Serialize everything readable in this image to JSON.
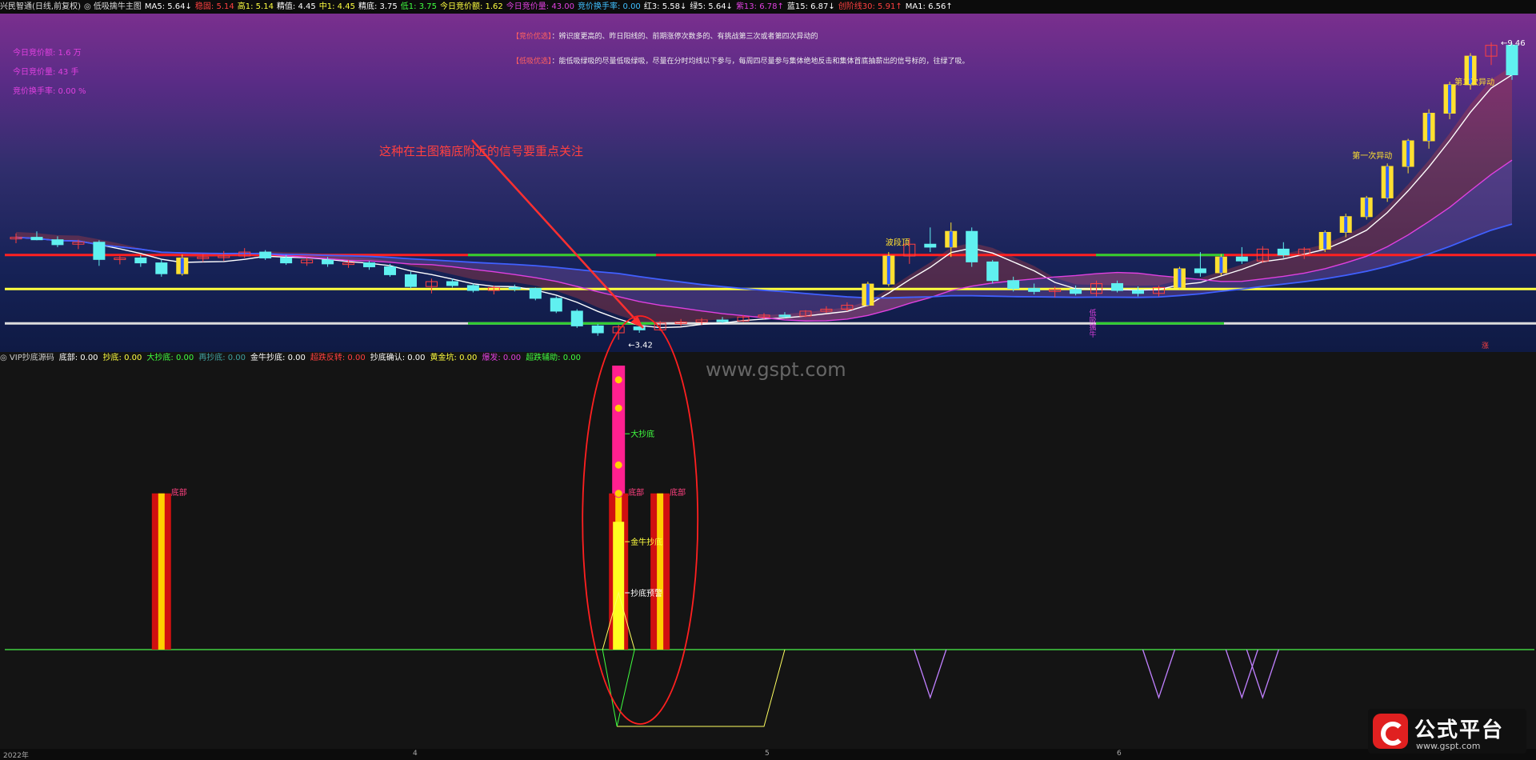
{
  "header": {
    "items": [
      {
        "text": "兴民智通(日线,前复权)",
        "color": "#dddddd"
      },
      {
        "text": "◎ 低吸擒牛主图",
        "color": "#dddddd"
      },
      {
        "text": "MA5: 5.64↓",
        "color": "#ffffff"
      },
      {
        "text": "稳固: 5.14",
        "color": "#ff4040"
      },
      {
        "text": "高1: 5.14",
        "color": "#ffff40"
      },
      {
        "text": "精值: 4.45",
        "color": "#ffffff"
      },
      {
        "text": "中1: 4.45",
        "color": "#ffff40"
      },
      {
        "text": "精底: 3.75",
        "color": "#ffffff"
      },
      {
        "text": "低1: 3.75",
        "color": "#40ff40"
      },
      {
        "text": "今日竞价额: 1.62",
        "color": "#ffff40"
      },
      {
        "text": "今日竞价量: 43.00",
        "color": "#e040e0"
      },
      {
        "text": "竞价换手率: 0.00",
        "color": "#40c0ff"
      },
      {
        "text": "红3: 5.58↓",
        "color": "#ffffff"
      },
      {
        "text": "绿5: 5.64↓",
        "color": "#ffffff"
      },
      {
        "text": "紫13: 6.78↑",
        "color": "#e040e0"
      },
      {
        "text": "蓝15: 6.87↓",
        "color": "#ffffff"
      },
      {
        "text": "创阶线30: 5.91↑",
        "color": "#ff4040"
      },
      {
        "text": "MA1: 6.56↑",
        "color": "#ffffff"
      }
    ]
  },
  "left_panel": {
    "line1": "今日竞价额: 1.6 万",
    "line2": "今日竞价量: 43 手",
    "line3": "竞价换手率: 0.00 %"
  },
  "notes": {
    "note1_key": "【竞价优选】",
    "note1_text": "：辨识度更高的、昨日阳线的、前期涨停次数多的、有挑战第三次或者第四次异动的",
    "note2_key": "【低吸优选】",
    "note2_text": "：能低吸绿吸的尽量低吸绿吸，尽量在分时均线以下参与，每周四尽量参与集体绝地反击和集体首底抽薪出的信号标的，往绿了吸。"
  },
  "annotation": {
    "arrow_text": "这种在主图箱底附近的信号要重点关注"
  },
  "main_labels": {
    "low_price": "3.42",
    "high_price": "9.46",
    "first_move": "第一次异动",
    "second_move": "第二次异动",
    "band_label": "波段顶",
    "bull_text": "低吸擒牛",
    "zhang": "涨"
  },
  "indicator": {
    "header": [
      {
        "text": "◎ VIP抄底源码",
        "color": "#cccccc"
      },
      {
        "text": "底部: 0.00",
        "color": "#ffffff"
      },
      {
        "text": "抄底: 0.00",
        "color": "#ffff40"
      },
      {
        "text": "大抄底: 0.00",
        "color": "#40ff40"
      },
      {
        "text": "再抄底: 0.00",
        "color": "#40a0a0"
      },
      {
        "text": "金牛抄底: 0.00",
        "color": "#ffffff"
      },
      {
        "text": "超跌反转: 0.00",
        "color": "#ff4040"
      },
      {
        "text": "抄底确认: 0.00",
        "color": "#ffffff"
      },
      {
        "text": "黄金坑: 0.00",
        "color": "#ffff40"
      },
      {
        "text": "爆发: 0.00",
        "color": "#e040e0"
      },
      {
        "text": "超跌辅助: 0.00",
        "color": "#40ff40"
      }
    ],
    "labels": {
      "bottom1": "底部",
      "bottom2": "底部",
      "bottom3": "底部",
      "big_bottom": "大抄底",
      "golden_bull": "金牛抄底",
      "bottom_warn": "抄底预警"
    }
  },
  "watermark": "www.gspt.com",
  "logo": {
    "name": "公式平台",
    "url": "www.gspt.com"
  },
  "xaxis": {
    "labels": [
      "2022年",
      "4",
      "5",
      "6"
    ]
  },
  "chart_data": [
    {
      "type": "candlestick",
      "title": "低吸擒牛主图",
      "price_lines": [
        {
          "name": "稳固",
          "value": 5.14,
          "color": "#ff2020"
        },
        {
          "name": "精值",
          "value": 4.45,
          "color": "#ffff40"
        },
        {
          "name": "精底",
          "value": 3.75,
          "color": "#dddddd"
        }
      ],
      "ylim": [
        3.3,
        9.8
      ],
      "min_low": 3.42,
      "max_high": 9.46,
      "candles": [
        {
          "o": 5.48,
          "h": 5.58,
          "l": 5.38,
          "c": 5.5
        },
        {
          "o": 5.5,
          "h": 5.62,
          "l": 5.44,
          "c": 5.45
        },
        {
          "o": 5.45,
          "h": 5.52,
          "l": 5.3,
          "c": 5.35
        },
        {
          "o": 5.36,
          "h": 5.45,
          "l": 5.26,
          "c": 5.4
        },
        {
          "o": 5.4,
          "h": 5.44,
          "l": 4.92,
          "c": 5.05
        },
        {
          "o": 5.05,
          "h": 5.12,
          "l": 4.95,
          "c": 5.08
        },
        {
          "o": 5.08,
          "h": 5.14,
          "l": 4.9,
          "c": 4.98
        },
        {
          "o": 4.98,
          "h": 5.04,
          "l": 4.7,
          "c": 4.76
        },
        {
          "o": 4.76,
          "h": 5.15,
          "l": 4.72,
          "c": 5.08
        },
        {
          "o": 5.08,
          "h": 5.16,
          "l": 5.0,
          "c": 5.1
        },
        {
          "o": 5.1,
          "h": 5.22,
          "l": 5.02,
          "c": 5.12
        },
        {
          "o": 5.12,
          "h": 5.28,
          "l": 5.08,
          "c": 5.2
        },
        {
          "o": 5.2,
          "h": 5.24,
          "l": 5.04,
          "c": 5.08
        },
        {
          "o": 5.08,
          "h": 5.14,
          "l": 4.94,
          "c": 4.98
        },
        {
          "o": 4.98,
          "h": 5.08,
          "l": 4.92,
          "c": 5.04
        },
        {
          "o": 5.04,
          "h": 5.1,
          "l": 4.9,
          "c": 4.96
        },
        {
          "o": 4.96,
          "h": 5.04,
          "l": 4.88,
          "c": 4.98
        },
        {
          "o": 4.98,
          "h": 5.02,
          "l": 4.84,
          "c": 4.9
        },
        {
          "o": 4.9,
          "h": 4.96,
          "l": 4.7,
          "c": 4.74
        },
        {
          "o": 4.74,
          "h": 4.8,
          "l": 4.46,
          "c": 4.5
        },
        {
          "o": 4.5,
          "h": 4.66,
          "l": 4.36,
          "c": 4.6
        },
        {
          "o": 4.6,
          "h": 4.66,
          "l": 4.48,
          "c": 4.52
        },
        {
          "o": 4.52,
          "h": 4.56,
          "l": 4.38,
          "c": 4.42
        },
        {
          "o": 4.42,
          "h": 4.52,
          "l": 4.34,
          "c": 4.48
        },
        {
          "o": 4.48,
          "h": 4.54,
          "l": 4.4,
          "c": 4.46
        },
        {
          "o": 4.46,
          "h": 4.48,
          "l": 4.22,
          "c": 4.26
        },
        {
          "o": 4.26,
          "h": 4.3,
          "l": 3.96,
          "c": 4.0
        },
        {
          "o": 4.0,
          "h": 4.04,
          "l": 3.66,
          "c": 3.7
        },
        {
          "o": 3.7,
          "h": 3.74,
          "l": 3.5,
          "c": 3.56
        },
        {
          "o": 3.56,
          "h": 3.72,
          "l": 3.42,
          "c": 3.68
        },
        {
          "o": 3.68,
          "h": 3.74,
          "l": 3.56,
          "c": 3.62
        },
        {
          "o": 3.62,
          "h": 3.8,
          "l": 3.6,
          "c": 3.76
        },
        {
          "o": 3.76,
          "h": 3.84,
          "l": 3.7,
          "c": 3.78
        },
        {
          "o": 3.78,
          "h": 3.86,
          "l": 3.72,
          "c": 3.82
        },
        {
          "o": 3.82,
          "h": 3.88,
          "l": 3.76,
          "c": 3.8
        },
        {
          "o": 3.8,
          "h": 3.92,
          "l": 3.78,
          "c": 3.88
        },
        {
          "o": 3.88,
          "h": 3.96,
          "l": 3.84,
          "c": 3.92
        },
        {
          "o": 3.92,
          "h": 3.98,
          "l": 3.86,
          "c": 3.9
        },
        {
          "o": 3.9,
          "h": 4.02,
          "l": 3.88,
          "c": 4.0
        },
        {
          "o": 4.0,
          "h": 4.1,
          "l": 3.96,
          "c": 4.04
        },
        {
          "o": 4.04,
          "h": 4.18,
          "l": 4.0,
          "c": 4.12
        },
        {
          "o": 4.12,
          "h": 4.6,
          "l": 4.1,
          "c": 4.55
        },
        {
          "o": 4.55,
          "h": 5.2,
          "l": 4.5,
          "c": 5.12
        },
        {
          "o": 5.12,
          "h": 5.48,
          "l": 4.96,
          "c": 5.36
        },
        {
          "o": 5.36,
          "h": 5.7,
          "l": 5.2,
          "c": 5.3
        },
        {
          "o": 5.3,
          "h": 5.8,
          "l": 5.1,
          "c": 5.62
        },
        {
          "o": 5.62,
          "h": 5.7,
          "l": 4.9,
          "c": 5.0
        },
        {
          "o": 5.0,
          "h": 5.04,
          "l": 4.56,
          "c": 4.62
        },
        {
          "o": 4.62,
          "h": 4.7,
          "l": 4.4,
          "c": 4.46
        },
        {
          "o": 4.46,
          "h": 4.56,
          "l": 4.34,
          "c": 4.4
        },
        {
          "o": 4.4,
          "h": 4.5,
          "l": 4.28,
          "c": 4.44
        },
        {
          "o": 4.44,
          "h": 4.52,
          "l": 4.32,
          "c": 4.36
        },
        {
          "o": 4.36,
          "h": 4.62,
          "l": 4.3,
          "c": 4.56
        },
        {
          "o": 4.56,
          "h": 4.62,
          "l": 4.38,
          "c": 4.42
        },
        {
          "o": 4.42,
          "h": 4.5,
          "l": 4.3,
          "c": 4.36
        },
        {
          "o": 4.36,
          "h": 4.52,
          "l": 4.3,
          "c": 4.48
        },
        {
          "o": 4.48,
          "h": 4.9,
          "l": 4.44,
          "c": 4.86
        },
        {
          "o": 4.86,
          "h": 5.2,
          "l": 4.7,
          "c": 4.78
        },
        {
          "o": 4.78,
          "h": 5.16,
          "l": 4.72,
          "c": 5.1
        },
        {
          "o": 5.1,
          "h": 5.3,
          "l": 4.96,
          "c": 5.02
        },
        {
          "o": 5.02,
          "h": 5.32,
          "l": 4.98,
          "c": 5.26
        },
        {
          "o": 5.26,
          "h": 5.4,
          "l": 5.08,
          "c": 5.14
        },
        {
          "o": 5.14,
          "h": 5.3,
          "l": 5.06,
          "c": 5.26
        },
        {
          "o": 5.26,
          "h": 5.64,
          "l": 5.2,
          "c": 5.6
        },
        {
          "o": 5.6,
          "h": 5.98,
          "l": 5.5,
          "c": 5.92
        },
        {
          "o": 5.92,
          "h": 6.34,
          "l": 5.86,
          "c": 6.3
        },
        {
          "o": 6.3,
          "h": 7.0,
          "l": 6.22,
          "c": 6.94
        },
        {
          "o": 6.94,
          "h": 7.5,
          "l": 6.8,
          "c": 7.46
        },
        {
          "o": 7.46,
          "h": 8.1,
          "l": 7.3,
          "c": 8.02
        },
        {
          "o": 8.02,
          "h": 8.66,
          "l": 7.9,
          "c": 8.6
        },
        {
          "o": 8.6,
          "h": 9.24,
          "l": 8.5,
          "c": 9.18
        },
        {
          "o": 9.18,
          "h": 9.46,
          "l": 9.0,
          "c": 9.4
        },
        {
          "o": 9.4,
          "h": 9.44,
          "l": 8.7,
          "c": 8.8
        }
      ]
    },
    {
      "type": "bar",
      "title": "VIP抄底源码",
      "bottom_bars": [
        {
          "index": 7,
          "value": 0.55,
          "label": "底部"
        },
        {
          "index": 29,
          "value": 0.55,
          "label": "底部"
        },
        {
          "index": 31,
          "value": 0.55,
          "label": "底部"
        }
      ],
      "signal_bar": {
        "index": 29,
        "value": 1.0,
        "magenta_from": 0.55,
        "yellow_to": 0.45
      },
      "signal_labels": [
        {
          "index": 29,
          "value": 0.76,
          "label": "大抄底"
        },
        {
          "index": 29,
          "value": 0.38,
          "label": "金牛抄底"
        },
        {
          "index": 29,
          "value": 0.2,
          "label": "抄底预警"
        }
      ]
    }
  ]
}
